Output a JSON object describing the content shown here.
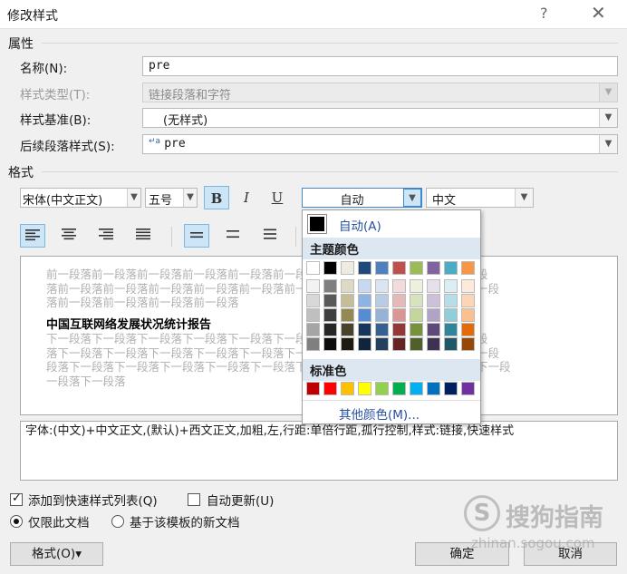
{
  "dialog": {
    "title": "修改样式",
    "help": "?",
    "close": "✕"
  },
  "properties": {
    "section": "属性",
    "name_label": "名称(N):",
    "name_value": "pre",
    "type_label": "样式类型(T):",
    "type_value": "链接段落和字符",
    "base_label": "样式基准(B):",
    "base_value": "(无样式)",
    "next_label": "后续段落样式(S):",
    "next_value": "pre",
    "next_icon": "↵a"
  },
  "format": {
    "section": "格式",
    "font": "宋体(中文正文)",
    "size": "五号",
    "bold": "B",
    "italic": "I",
    "underline": "U",
    "color": "自动",
    "lang": "中文"
  },
  "preview": {
    "prev_lines": [
      "前一段落前一段落前一段落前一段落前一段落前一段落前一段落前一段落前一段落前一段",
      "落前一段落前一段落前一段落前一段落前一段落前一段落前一段落前一段落前一段落前一段",
      "落前一段落前一段落前一段落前一段落"
    ],
    "sample": "中国互联网络发展状况统计报告",
    "next_lines": [
      "下一段落下一段落下一段落下一段落下一段落下一段落下一段落下一段落下一段落下一段",
      "落下一段落下一段落下一段落下一段落下一段落下一段落下一段落下一段落下一段落下一段",
      "段落下一段落下一段落下一段落下一段落下一段落下一段落下一段落下一段落下一段落下一段",
      "一段落下一段落"
    ]
  },
  "description": "字体:(中文)+中文正文,(默认)+西文正文,加粗,左,行距:单倍行距,孤行控制,样式:链接,快速样式",
  "options": {
    "add_quick": "添加到快速样式列表(Q)",
    "auto_update": "自动更新(U)",
    "only_doc": "仅限此文档",
    "template_doc": "基于该模板的新文档"
  },
  "buttons": {
    "format": "格式(O)▾",
    "ok": "确定",
    "cancel": "取消"
  },
  "watermark": {
    "brand": "搜狗指南",
    "url": "zhinan.sogou.com"
  },
  "color_picker": {
    "auto_label": "自动(A)",
    "theme_header": "主题颜色",
    "standard_header": "标准色",
    "more_label": "其他颜色(M)...",
    "theme_top": [
      "#ffffff",
      "#000000",
      "#eeece1",
      "#1f497d",
      "#4f81bd",
      "#c0504d",
      "#9bbb59",
      "#8064a2",
      "#4bacc6",
      "#f79646"
    ],
    "theme_shades": [
      [
        "#f2f2f2",
        "#7f7f7f",
        "#ddd9c3",
        "#c6d9f0",
        "#dbe5f1",
        "#f2dcdb",
        "#ebf1dd",
        "#e5e0ec",
        "#dbeef3",
        "#fdeada"
      ],
      [
        "#d8d8d8",
        "#595959",
        "#c4bd97",
        "#8db3e2",
        "#b8cce4",
        "#e5b9b7",
        "#d7e3bc",
        "#ccc1d9",
        "#b7dde8",
        "#fbd5b5"
      ],
      [
        "#bfbfbf",
        "#3f3f3f",
        "#938953",
        "#548dd4",
        "#95b3d7",
        "#d99694",
        "#c3d69b",
        "#b2a2c7",
        "#92cddc",
        "#fac08f"
      ],
      [
        "#a5a5a5",
        "#262626",
        "#494429",
        "#17365d",
        "#366092",
        "#953734",
        "#76923c",
        "#5f497a",
        "#31859b",
        "#e36c09"
      ],
      [
        "#7f7f7f",
        "#0c0c0c",
        "#1d1b10",
        "#0f243e",
        "#244061",
        "#632423",
        "#4f6128",
        "#3f3151",
        "#205867",
        "#974806"
      ]
    ],
    "standard": [
      "#c00000",
      "#ff0000",
      "#ffc000",
      "#ffff00",
      "#92d050",
      "#00b050",
      "#00b0f0",
      "#0070c0",
      "#002060",
      "#7030a0"
    ]
  }
}
